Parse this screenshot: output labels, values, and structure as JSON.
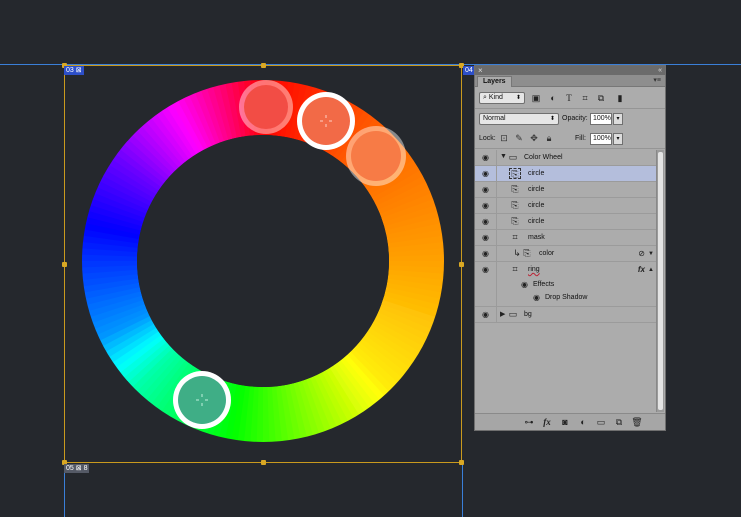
{
  "canvas": {
    "tag_top_left": "03",
    "tag_top_right": "04",
    "tag_bottom_left": "05"
  },
  "colors": {
    "background": "#25282d",
    "guide": "#3a7fd8",
    "frame": "#c99a1e",
    "knob_red": "#f24d45",
    "knob_salmon": "#f26a47",
    "knob_orange": "#f77b46",
    "knob_teal": "#3fae86"
  },
  "layers_panel": {
    "tab_title": "Layers",
    "filter": {
      "kind_label": "Kind",
      "icons": [
        "image-filter-icon",
        "adjustment-filter-icon",
        "type-filter-icon",
        "shape-filter-icon",
        "smart-object-filter-icon",
        "filter-toggle-icon"
      ]
    },
    "blend_mode": "Normal",
    "opacity_label": "Opacity:",
    "opacity_value": "100%",
    "lock_label": "Lock:",
    "fill_label": "Fill:",
    "fill_value": "100%",
    "layers": [
      {
        "name": "Color Wheel",
        "type": "group",
        "expanded": true
      },
      {
        "name": "circle",
        "type": "smart-object",
        "selected": true
      },
      {
        "name": "circle",
        "type": "smart-object"
      },
      {
        "name": "circle",
        "type": "smart-object"
      },
      {
        "name": "circle",
        "type": "smart-object"
      },
      {
        "name": "mask",
        "type": "shape"
      },
      {
        "name": "color",
        "type": "smart-object",
        "clipped": true
      },
      {
        "name": "ring",
        "type": "shape",
        "has_fx": true
      },
      {
        "name": "Effects",
        "type": "effects-header"
      },
      {
        "name": "Drop Shadow",
        "type": "effect"
      },
      {
        "name": "bg",
        "type": "group",
        "expanded": false
      }
    ],
    "fx_label": "fx"
  }
}
